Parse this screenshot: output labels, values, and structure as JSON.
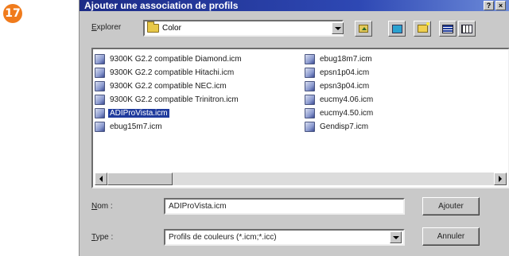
{
  "step_number": "17",
  "dialog": {
    "title": "Ajouter une association de profils",
    "title_buttons": [
      "?",
      "×"
    ]
  },
  "toolbar": {
    "look_in_label": "Explorer",
    "folder": "Color",
    "icons": [
      "up-folder-icon",
      "desktop-icon",
      "new-folder-icon",
      "list-view-icon",
      "details-view-icon"
    ]
  },
  "files": [
    {
      "name": "9300K G2.2 compatible Diamond.icm",
      "icon": "monitor-profile-icon",
      "selected": false
    },
    {
      "name": "9300K G2.2 compatible Hitachi.icm",
      "icon": "monitor-profile-icon",
      "selected": false
    },
    {
      "name": "9300K G2.2 compatible NEC.icm",
      "icon": "monitor-profile-icon",
      "selected": false
    },
    {
      "name": "9300K G2.2 compatible Trinitron.icm",
      "icon": "monitor-profile-icon",
      "selected": false
    },
    {
      "name": "ADIProVista.icm",
      "icon": "color-profile-icon",
      "selected": true
    },
    {
      "name": "ebug15m7.icm",
      "icon": "color-profile-icon",
      "selected": false
    },
    {
      "name": "ebug18m7.icm",
      "icon": "color-profile-icon",
      "selected": false
    },
    {
      "name": "epsn1p04.icm",
      "icon": "color-profile-icon",
      "selected": false
    },
    {
      "name": "epsn3p04.icm",
      "icon": "color-profile-icon",
      "selected": false
    },
    {
      "name": "eucmy4.06.icm",
      "icon": "color-profile-icon",
      "selected": false
    },
    {
      "name": "eucmy4.50.icm",
      "icon": "color-profile-icon",
      "selected": false
    },
    {
      "name": "Gendisp7.icm",
      "icon": "color-profile-icon",
      "selected": false
    }
  ],
  "form": {
    "name_label": "Nom :",
    "name_value": "ADIProVista.icm",
    "type_label": "Type :",
    "type_value": "Profils de couleurs (*.icm;*.icc)"
  },
  "buttons": {
    "add": "Ajouter",
    "cancel": "Annuler"
  },
  "colors": {
    "titlebar": "#1c2b86",
    "selection": "#1f3b9d",
    "dialog_face": "#c9c9c9",
    "badge": "#f07b1c"
  }
}
